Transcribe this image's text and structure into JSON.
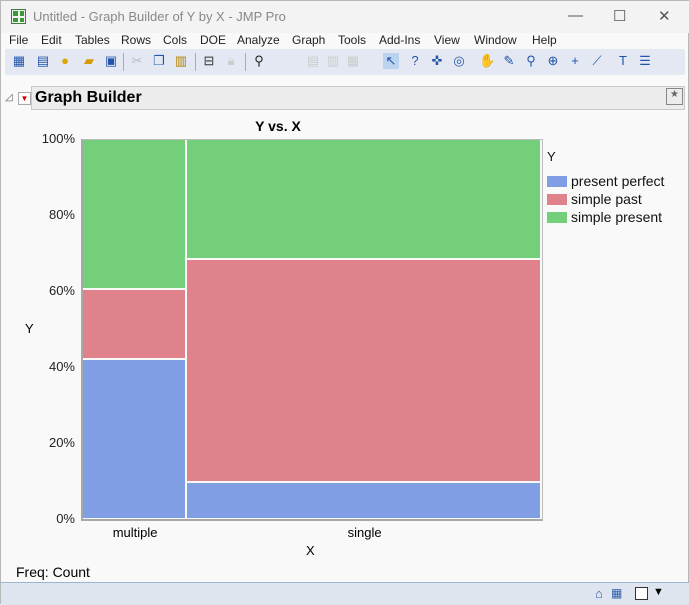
{
  "window": {
    "title": "Untitled - Graph Builder of Y by X - JMP Pro",
    "minimize": "—",
    "maximize": "☐",
    "close": "✕"
  },
  "menu": [
    "File",
    "Edit",
    "Tables",
    "Rows",
    "Cols",
    "DOE",
    "Analyze",
    "Graph",
    "Tools",
    "Add-Ins",
    "View",
    "Window",
    "Help"
  ],
  "panel": {
    "title": "Graph Builder"
  },
  "footer": {
    "freq": "Freq: Count"
  },
  "chart_data": {
    "type": "mosaic",
    "title": "Y vs. X",
    "xlabel": "X",
    "ylabel": "Y",
    "yticks": [
      "0%",
      "20%",
      "40%",
      "60%",
      "80%",
      "100%"
    ],
    "categories": [
      "multiple",
      "single"
    ],
    "column_share": [
      0.227,
      0.773
    ],
    "legend_title": "Y",
    "series": [
      {
        "name": "present perfect",
        "color": "#7f9ee4",
        "values": [
          42.0,
          9.7
        ]
      },
      {
        "name": "simple past",
        "color": "#e0828c",
        "values": [
          18.5,
          58.7
        ]
      },
      {
        "name": "simple present",
        "color": "#74cf7a",
        "values": [
          39.5,
          31.6
        ]
      }
    ]
  }
}
